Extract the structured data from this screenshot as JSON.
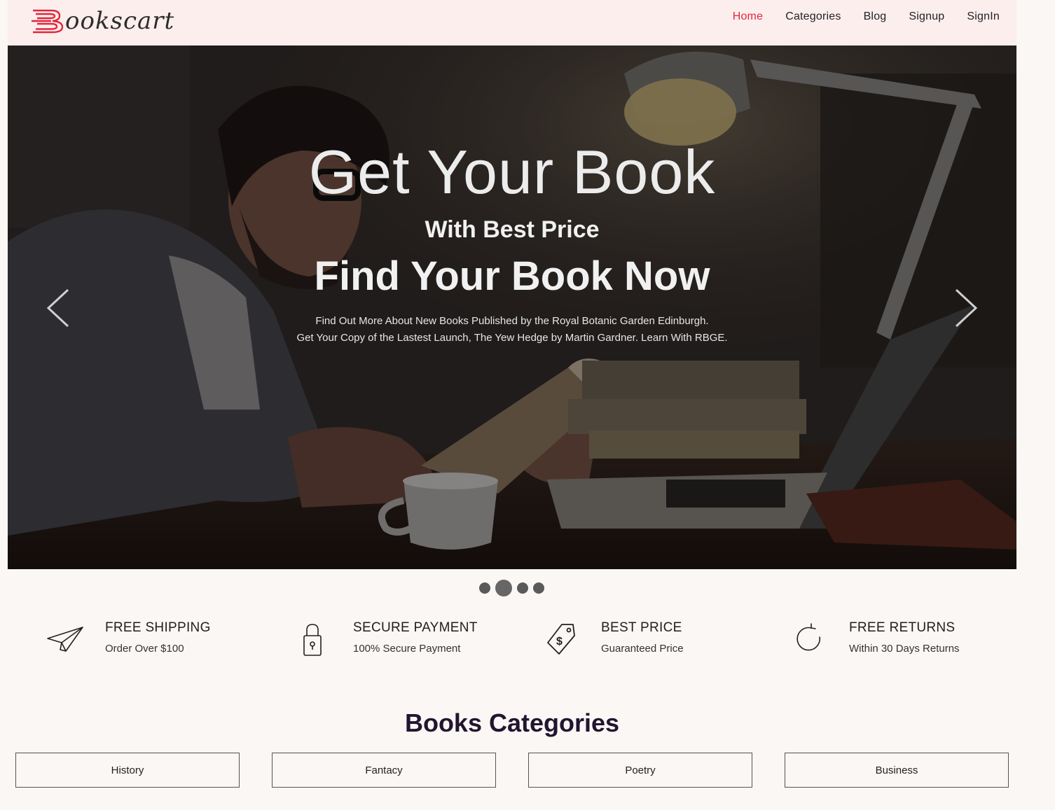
{
  "brand": {
    "name": "ookscart",
    "logo_letter": "B"
  },
  "nav": {
    "items": [
      {
        "label": "Home",
        "active": true
      },
      {
        "label": "Categories"
      },
      {
        "label": "Blog"
      },
      {
        "label": "Signup"
      },
      {
        "label": "SignIn"
      }
    ]
  },
  "hero": {
    "title": "Get Your Book",
    "subtitle": "With Best Price",
    "tagline": "Find Your Book Now",
    "description_line1": "Find Out More About New Books Published by the Royal Botanic Garden Edinburgh.",
    "description_line2": "Get Your Copy of the Lastest Launch, The Yew Hedge by Martin Gardner. Learn With RBGE.",
    "prev_icon": "chevron-left-icon",
    "next_icon": "chevron-right-icon",
    "slide_count": 4,
    "active_slide": 2
  },
  "features": [
    {
      "icon": "paper-plane-icon",
      "title": "FREE SHIPPING",
      "subtitle": "Order Over $100"
    },
    {
      "icon": "lock-icon",
      "title": "SECURE PAYMENT",
      "subtitle": "100% Secure Payment"
    },
    {
      "icon": "price-tag-icon",
      "title": "BEST PRICE",
      "subtitle": "Guaranteed Price"
    },
    {
      "icon": "refresh-icon",
      "title": "FREE RETURNS",
      "subtitle": "Within 30 Days Returns"
    }
  ],
  "categories": {
    "heading": "Books Categories",
    "items": [
      "History",
      "Fantacy",
      "Poetry",
      "Business"
    ]
  },
  "colors": {
    "nav_bg": "#fdeeee",
    "accent": "#e0283a",
    "page_bg": "#faf7f4",
    "heading": "#221530"
  }
}
